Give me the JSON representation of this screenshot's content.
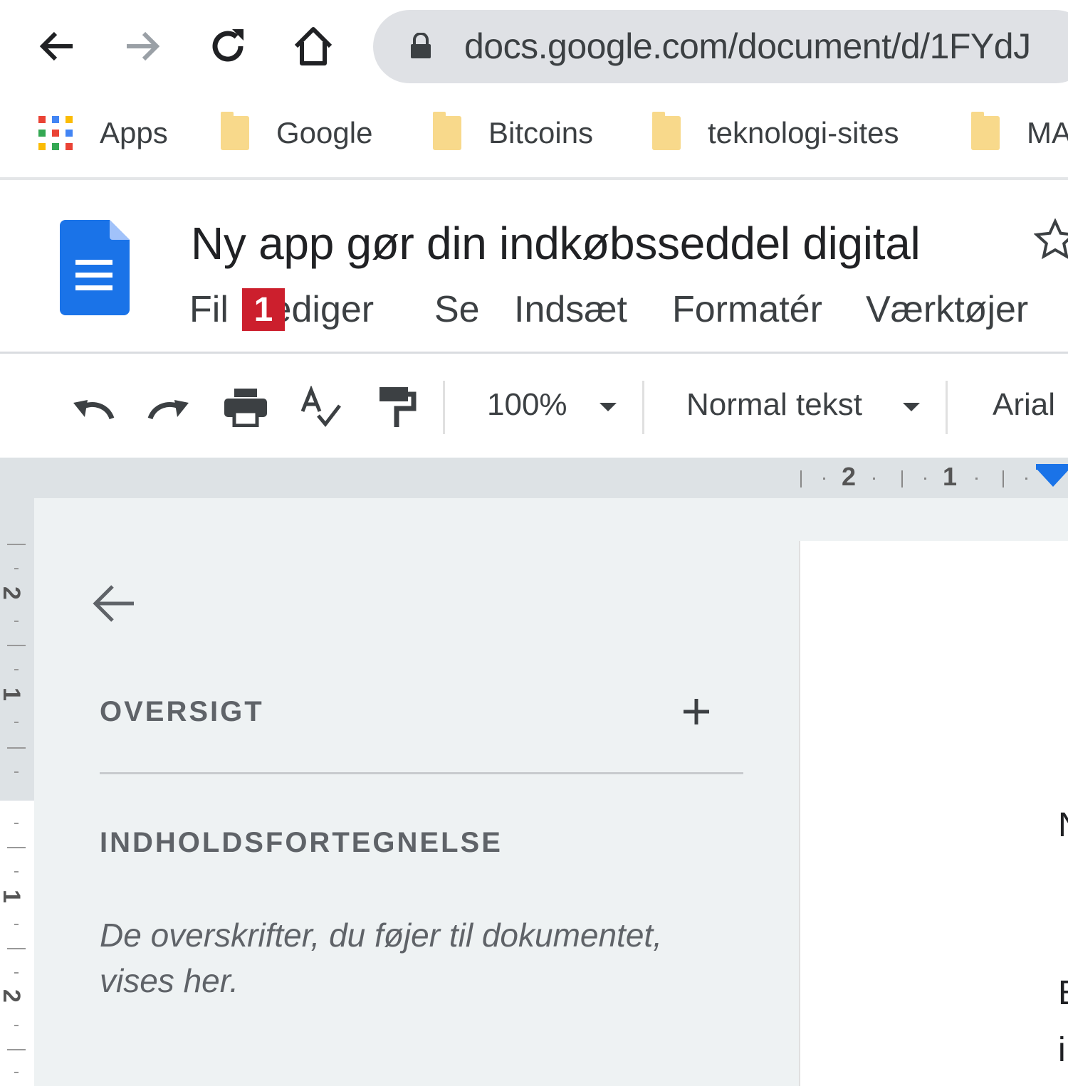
{
  "browser": {
    "url": "docs.google.com/document/d/1FYdJ",
    "nav": {
      "back_icon": "arrow-left-icon",
      "forward_icon": "arrow-right-icon",
      "reload_icon": "reload-icon",
      "home_icon": "home-icon",
      "lock_icon": "lock-icon"
    },
    "bookmarks": [
      {
        "label": "Apps",
        "icon": "apps-grid-icon"
      },
      {
        "label": "Google",
        "icon": "folder-icon"
      },
      {
        "label": "Bitcoins",
        "icon": "folder-icon"
      },
      {
        "label": "teknologi-sites",
        "icon": "folder-icon"
      },
      {
        "label": "MA",
        "icon": "folder-icon"
      }
    ]
  },
  "doc": {
    "title": "Ny app gør din indkøbsseddel digital",
    "menu": [
      "Fil",
      "Rediger",
      "Se",
      "Indsæt",
      "Formatér",
      "Værktøjer"
    ],
    "badge": "1"
  },
  "toolbar": {
    "zoom": "100%",
    "style": "Normal tekst",
    "font": "Arial"
  },
  "ruler": {
    "h_labels": [
      "2",
      "1"
    ],
    "v_labels": [
      "2",
      "1",
      "1",
      "2"
    ]
  },
  "outline": {
    "section_title": "OVERSIGT",
    "toc_title": "INDHOLDSFORTEGNELSE",
    "hint": "De overskrifter, du føjer til dokumentet, vises her."
  },
  "page_edge_text": [
    "N",
    "E",
    "i"
  ],
  "colors": {
    "docs_blue": "#1a73e8",
    "badge_red": "#cc1f2d",
    "folder_yellow": "#f8d98b"
  }
}
